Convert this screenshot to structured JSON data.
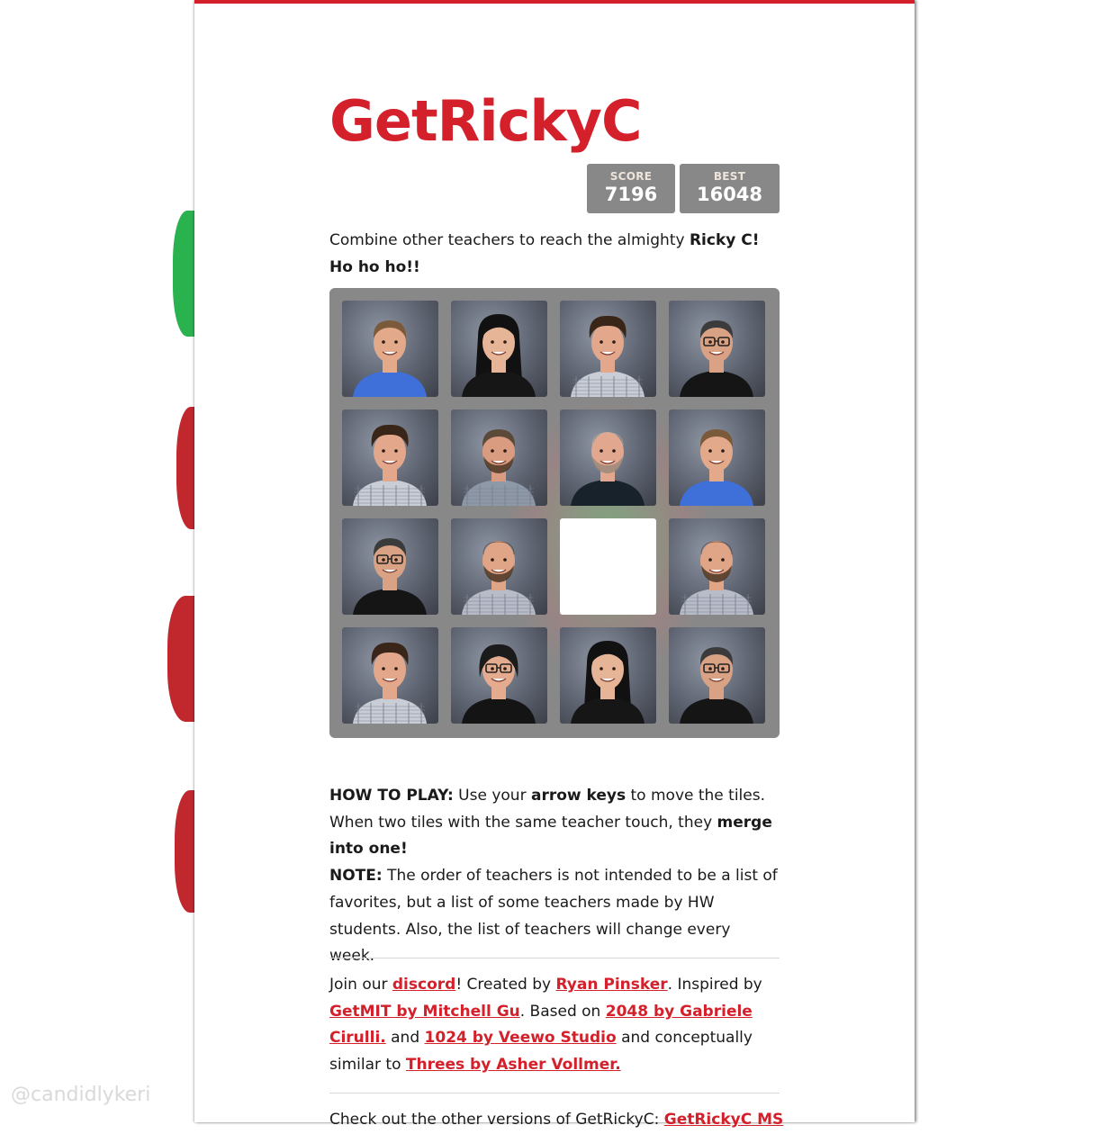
{
  "watermark": "@candidlykeri",
  "title": "GetRickyC",
  "score": {
    "label": "SCORE",
    "value": "7196"
  },
  "best": {
    "label": "BEST",
    "value": "16048"
  },
  "intro": {
    "text": "Combine other teachers to reach the almighty ",
    "bold": "Ricky C! Ho ho ho!!"
  },
  "board": {
    "rows": [
      [
        {
          "teacher": "blonde-man-blue-shirt"
        },
        {
          "teacher": "woman-long-black-hair"
        },
        {
          "teacher": "curly-hair-man-plaid"
        },
        {
          "teacher": "man-glasses-black-shirt"
        }
      ],
      [
        {
          "teacher": "curly-hair-man-plaid"
        },
        {
          "teacher": "bearded-man-plaid"
        },
        {
          "teacher": "bald-man-dark-shirt"
        },
        {
          "teacher": "blonde-man-blue-shirt"
        }
      ],
      [
        {
          "teacher": "man-glasses-black-shirt"
        },
        {
          "teacher": "bald-bearded-man-plaid"
        },
        {
          "teacher": "empty"
        },
        {
          "teacher": "bald-bearded-man-plaid"
        }
      ],
      [
        {
          "teacher": "curly-hair-man-plaid"
        },
        {
          "teacher": "woman-glasses-black-shirt"
        },
        {
          "teacher": "woman-long-black-hair"
        },
        {
          "teacher": "man-glasses-black-shirt"
        }
      ]
    ]
  },
  "howto": {
    "label": "HOW TO PLAY:",
    "t1": " Use your ",
    "b1": "arrow keys",
    "t2": " to move the tiles. When two tiles with the same teacher touch, they ",
    "b2": "merge into one!",
    "note_label": "NOTE:",
    "note_text": " The order of teachers is not intended to be a list of favorites, but a list of some teachers made by HW students. Also, the list of teachers will change every week."
  },
  "credits": {
    "t1": "Join our ",
    "discord": "discord",
    "t2": "! Created by ",
    "author": "Ryan Pinsker",
    "t3": ". Inspired by ",
    "getmit": "GetMIT by Mitchell Gu",
    "t4": ". Based on ",
    "l2048": "2048 by Gabriele Cirulli.",
    "t5": " and ",
    "l1024": "1024 by Veewo Studio",
    "t6": " and conceptually similar to ",
    "threes": "Threes by Asher Vollmer."
  },
  "versions": {
    "text": "Check out the other versions of GetRickyC: ",
    "link": "GetRickyC MS"
  },
  "colors": {
    "accent": "#d4202b",
    "board": "#888888",
    "score_box": "#888888"
  }
}
